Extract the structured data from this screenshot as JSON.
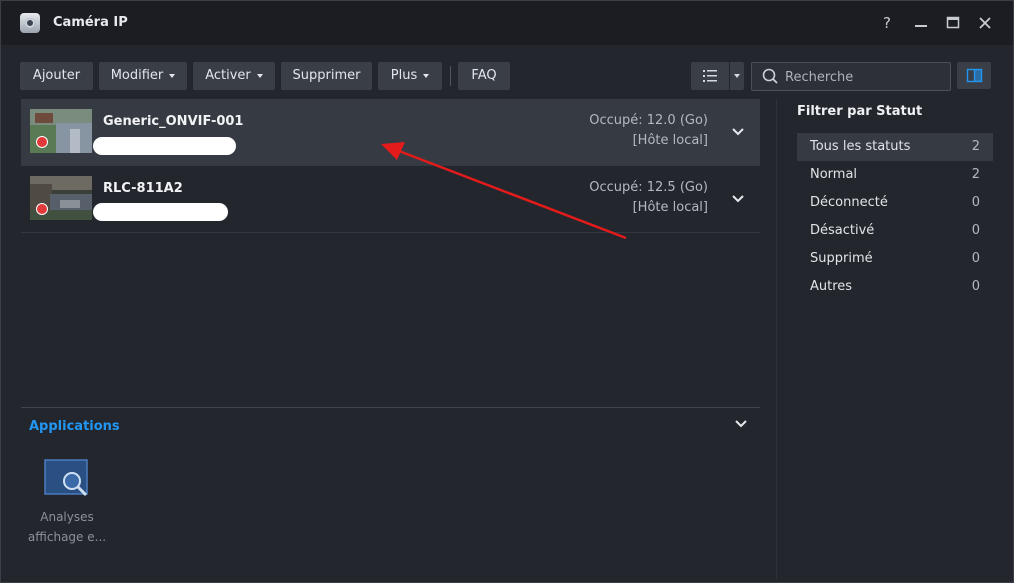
{
  "window": {
    "title": "Caméra IP"
  },
  "titlebar": {
    "help": "?",
    "minimize": "—",
    "maximize": "▣",
    "close": "✕"
  },
  "toolbar": {
    "add": "Ajouter",
    "modify": "Modifier",
    "activate": "Activer",
    "delete": "Supprimer",
    "more": "Plus",
    "faq": "FAQ"
  },
  "search": {
    "placeholder": "Recherche"
  },
  "cameras": [
    {
      "name": "Generic_ONVIF-001",
      "usage": "Occupé: 12.0 (Go)",
      "host": "[Hôte local]",
      "recording": true,
      "selected": true
    },
    {
      "name": "RLC-811A2",
      "usage": "Occupé: 12.5 (Go)",
      "host": "[Hôte local]",
      "recording": true,
      "selected": false
    }
  ],
  "applications": {
    "title": "Applications",
    "items": [
      {
        "label_line1": "Analyses",
        "label_line2": "affichage e..."
      }
    ]
  },
  "filter": {
    "title": "Filtrer par Statut",
    "items": [
      {
        "label": "Tous les statuts",
        "count": "2"
      },
      {
        "label": "Normal",
        "count": "2"
      },
      {
        "label": "Déconnecté",
        "count": "0"
      },
      {
        "label": "Désactivé",
        "count": "0"
      },
      {
        "label": "Supprimé",
        "count": "0"
      },
      {
        "label": "Autres",
        "count": "0"
      }
    ]
  },
  "colors": {
    "accent": "#2196f3",
    "recording": "#e23a3a",
    "annotation_arrow": "#e31b1b"
  }
}
